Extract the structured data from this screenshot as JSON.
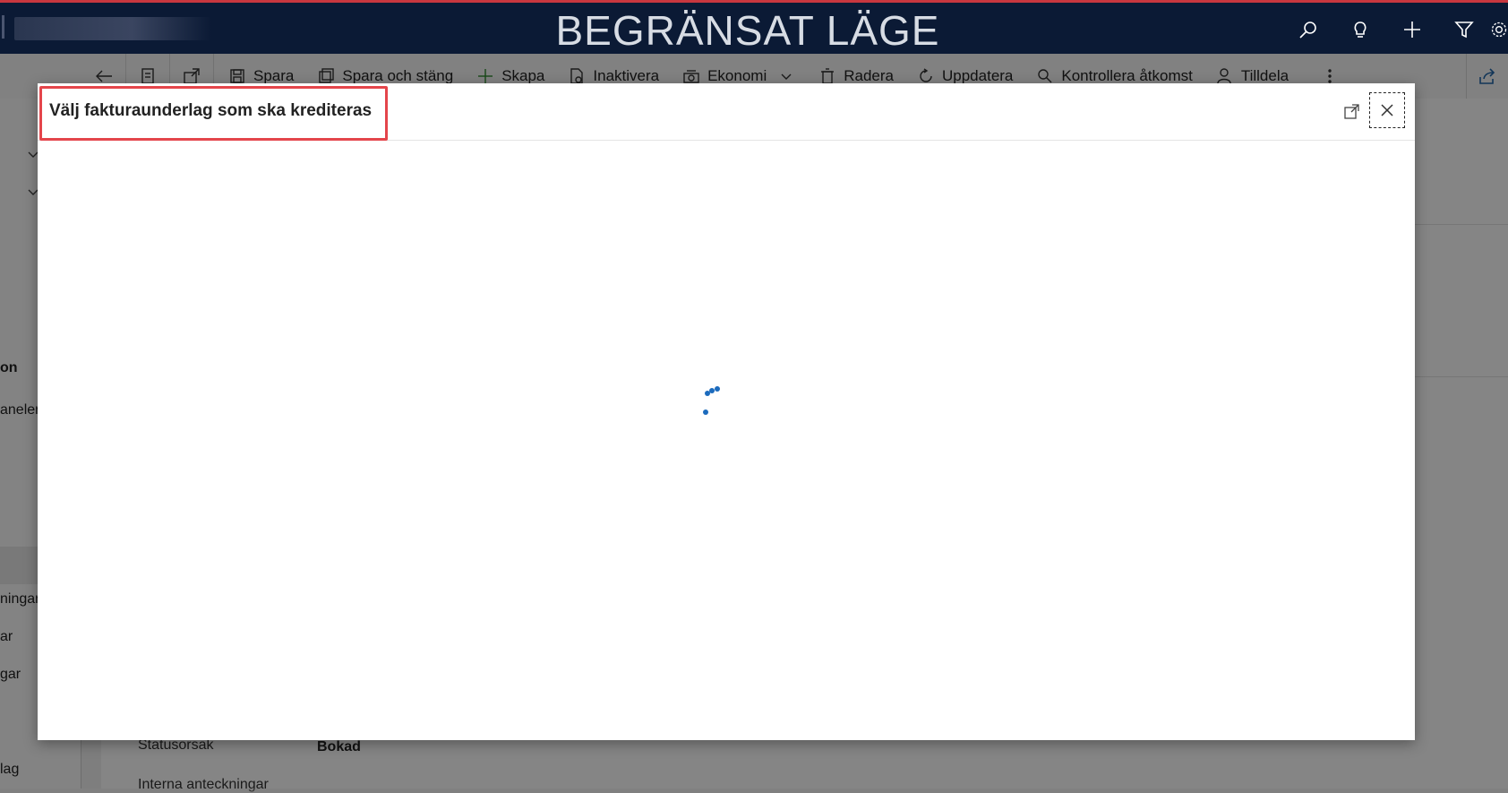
{
  "topbar": {
    "title": "BEGRÄNSAT LÄGE",
    "icons": [
      "search-icon",
      "lightbulb-icon",
      "plus-icon",
      "filter-icon",
      "settings-icon"
    ],
    "accent_color": "#c8373f",
    "background_color": "#0b1a35"
  },
  "commandbar": {
    "nav_icons": [
      "back-arrow-icon",
      "form-icon",
      "open-new-window-icon"
    ],
    "items": [
      {
        "label": "Spara",
        "icon": "save-icon"
      },
      {
        "label": "Spara och stäng",
        "icon": "save-close-icon"
      },
      {
        "label": "Skapa",
        "icon": "plus-icon"
      },
      {
        "label": "Inaktivera",
        "icon": "deactivate-icon"
      },
      {
        "label": "Ekonomi",
        "icon": "cash-register-icon"
      },
      {
        "label": "Radera",
        "icon": "trash-icon"
      },
      {
        "label": "Uppdatera",
        "icon": "refresh-icon"
      },
      {
        "label": "Kontrollera åtkomst",
        "icon": "key-search-icon"
      },
      {
        "label": "Tilldela",
        "icon": "assign-user-icon"
      }
    ]
  },
  "leftnav": {
    "items": [
      {
        "label": "on"
      },
      {
        "label": "aneler"
      },
      {
        "label": "ningar"
      },
      {
        "label": "ar"
      },
      {
        "label": "gar"
      },
      {
        "label": "lag"
      }
    ]
  },
  "form": {
    "status_label": "Statusorsak",
    "status_value": "Bokad",
    "notes_label": "Interna anteckningar"
  },
  "dialog": {
    "title": "Välj fakturaunderlag som ska krediteras",
    "loading": true,
    "spinner_color": "#1c6bbd",
    "highlight_color": "#e4454b"
  }
}
